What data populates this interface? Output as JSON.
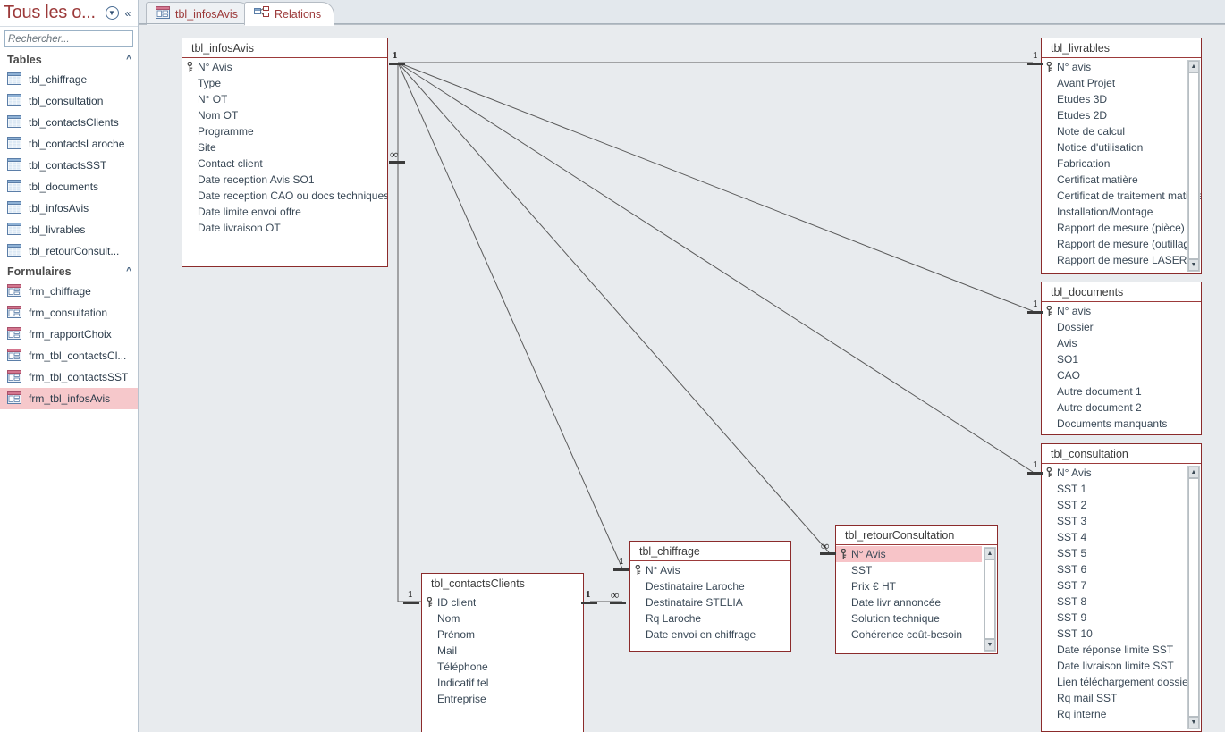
{
  "nav": {
    "title": "Tous les o...",
    "dropdown_icon": "chevron-down-circle-icon",
    "collapse_icon": "double-chevron-left-icon",
    "search": {
      "placeholder": "Rechercher...",
      "value": "",
      "icon": "search-icon"
    },
    "groups": [
      {
        "label": "Tables",
        "collapse_icon": "chevron-up-icon",
        "items": [
          {
            "label": "tbl_chiffrage",
            "icon": "table-icon",
            "selected": false
          },
          {
            "label": "tbl_consultation",
            "icon": "table-icon",
            "selected": false
          },
          {
            "label": "tbl_contactsClients",
            "icon": "table-icon",
            "selected": false
          },
          {
            "label": "tbl_contactsLaroche",
            "icon": "table-icon",
            "selected": false
          },
          {
            "label": "tbl_contactsSST",
            "icon": "table-icon",
            "selected": false
          },
          {
            "label": "tbl_documents",
            "icon": "table-icon",
            "selected": false
          },
          {
            "label": "tbl_infosAvis",
            "icon": "table-icon",
            "selected": false
          },
          {
            "label": "tbl_livrables",
            "icon": "table-icon",
            "selected": false
          },
          {
            "label": "tbl_retourConsult...",
            "icon": "table-icon",
            "selected": false
          }
        ]
      },
      {
        "label": "Formulaires",
        "collapse_icon": "chevron-up-icon",
        "items": [
          {
            "label": "frm_chiffrage",
            "icon": "form-icon",
            "selected": false
          },
          {
            "label": "frm_consultation",
            "icon": "form-icon",
            "selected": false
          },
          {
            "label": "frm_rapportChoix",
            "icon": "form-icon",
            "selected": false
          },
          {
            "label": "frm_tbl_contactsCl...",
            "icon": "form-icon",
            "selected": false
          },
          {
            "label": "frm_tbl_contactsSST",
            "icon": "form-icon",
            "selected": false
          },
          {
            "label": "frm_tbl_infosAvis",
            "icon": "form-icon",
            "selected": true
          }
        ]
      }
    ]
  },
  "tabs": [
    {
      "label": "tbl_infosAvis",
      "icon": "form-view-icon",
      "active": false
    },
    {
      "label": "Relations",
      "icon": "relations-icon",
      "active": true
    }
  ],
  "tables": [
    {
      "name": "tbl_infosAvis",
      "fields": [
        {
          "label": "N° Avis",
          "pk": true
        },
        {
          "label": "Type",
          "pk": false
        },
        {
          "label": "N° OT",
          "pk": false
        },
        {
          "label": "Nom OT",
          "pk": false
        },
        {
          "label": "Programme",
          "pk": false
        },
        {
          "label": "Site",
          "pk": false
        },
        {
          "label": "Contact client",
          "pk": false
        },
        {
          "label": "Date reception Avis SO1",
          "pk": false
        },
        {
          "label": "Date reception CAO ou docs techniques",
          "pk": false
        },
        {
          "label": "Date limite envoi offre",
          "pk": false
        },
        {
          "label": "Date livraison OT",
          "pk": false
        }
      ],
      "scrollbar": false
    },
    {
      "name": "tbl_livrables",
      "fields": [
        {
          "label": "N° avis",
          "pk": true
        },
        {
          "label": "Avant Projet",
          "pk": false
        },
        {
          "label": "Etudes 3D",
          "pk": false
        },
        {
          "label": "Etudes 2D",
          "pk": false
        },
        {
          "label": "Note de calcul",
          "pk": false
        },
        {
          "label": "Notice d'utilisation",
          "pk": false
        },
        {
          "label": "Fabrication",
          "pk": false
        },
        {
          "label": "Certificat matière",
          "pk": false
        },
        {
          "label": "Certificat de traitement matière",
          "pk": false
        },
        {
          "label": "Installation/Montage",
          "pk": false
        },
        {
          "label": "Rapport de mesure (pièce)",
          "pk": false
        },
        {
          "label": "Rapport de mesure (outillage)",
          "pk": false
        },
        {
          "label": "Rapport de mesure LASER",
          "pk": false
        }
      ],
      "scrollbar": true
    },
    {
      "name": "tbl_documents",
      "fields": [
        {
          "label": "N° avis",
          "pk": true
        },
        {
          "label": "Dossier",
          "pk": false
        },
        {
          "label": "Avis",
          "pk": false
        },
        {
          "label": "SO1",
          "pk": false
        },
        {
          "label": "CAO",
          "pk": false
        },
        {
          "label": "Autre document 1",
          "pk": false
        },
        {
          "label": "Autre document 2",
          "pk": false
        },
        {
          "label": "Documents manquants",
          "pk": false
        }
      ],
      "scrollbar": false
    },
    {
      "name": "tbl_consultation",
      "fields": [
        {
          "label": "N° Avis",
          "pk": true
        },
        {
          "label": "SST 1",
          "pk": false
        },
        {
          "label": "SST 2",
          "pk": false
        },
        {
          "label": "SST 3",
          "pk": false
        },
        {
          "label": "SST 4",
          "pk": false
        },
        {
          "label": "SST 5",
          "pk": false
        },
        {
          "label": "SST 6",
          "pk": false
        },
        {
          "label": "SST 7",
          "pk": false
        },
        {
          "label": "SST 8",
          "pk": false
        },
        {
          "label": "SST 9",
          "pk": false
        },
        {
          "label": "SST 10",
          "pk": false
        },
        {
          "label": "Date réponse limite SST",
          "pk": false
        },
        {
          "label": "Date livraison limite SST",
          "pk": false
        },
        {
          "label": "Lien téléchargement dossier",
          "pk": false
        },
        {
          "label": "Rq mail SST",
          "pk": false
        },
        {
          "label": "Rq interne",
          "pk": false
        }
      ],
      "scrollbar": true
    },
    {
      "name": "tbl_contactsClients",
      "fields": [
        {
          "label": "ID client",
          "pk": true
        },
        {
          "label": "Nom",
          "pk": false
        },
        {
          "label": "Prénom",
          "pk": false
        },
        {
          "label": "Mail",
          "pk": false
        },
        {
          "label": "Téléphone",
          "pk": false
        },
        {
          "label": "Indicatif tel",
          "pk": false
        },
        {
          "label": "Entreprise",
          "pk": false
        }
      ],
      "scrollbar": false
    },
    {
      "name": "tbl_chiffrage",
      "fields": [
        {
          "label": "N° Avis",
          "pk": true
        },
        {
          "label": "Destinataire Laroche",
          "pk": false
        },
        {
          "label": "Destinataire STELIA",
          "pk": false
        },
        {
          "label": "Rq Laroche",
          "pk": false
        },
        {
          "label": "Date envoi en chiffrage",
          "pk": false
        }
      ],
      "scrollbar": false
    },
    {
      "name": "tbl_retourConsultation",
      "fields": [
        {
          "label": "N° Avis",
          "pk": true,
          "selected": true
        },
        {
          "label": "SST",
          "pk": false
        },
        {
          "label": "Prix € HT",
          "pk": false
        },
        {
          "label": "Date livr annoncée",
          "pk": false
        },
        {
          "label": "Solution technique",
          "pk": false
        },
        {
          "label": "Cohérence coût-besoin",
          "pk": false
        }
      ],
      "scrollbar": true
    }
  ],
  "cardinality": {
    "one": "1",
    "many": "∞"
  },
  "colors": {
    "accent": "#9c3a3a",
    "table_border": "#8b2b2b",
    "canvas_bg": "#e8ebee",
    "selection": "#f6c8cb",
    "line": "#5a5a5a"
  }
}
